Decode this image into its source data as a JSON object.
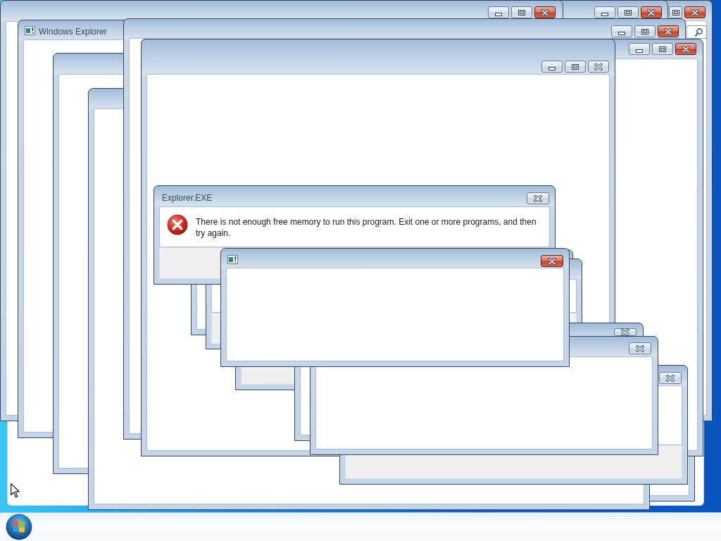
{
  "windows": [
    {
      "kind": "backdrop"
    },
    {
      "kind": "window",
      "active": true,
      "buttons": [
        {
          "kind": "maximize"
        },
        {
          "kind": "close"
        }
      ],
      "search_field": true
    },
    {
      "kind": "window",
      "active": true,
      "buttons": [
        {
          "kind": "minimize"
        },
        {
          "kind": "maximize"
        },
        {
          "kind": "close"
        }
      ]
    },
    {
      "kind": "window",
      "active": true,
      "buttons": [
        {
          "kind": "minimize"
        },
        {
          "kind": "maximize"
        },
        {
          "kind": "close"
        }
      ]
    },
    {
      "kind": "window",
      "app_icon": true,
      "title": "Windows Explorer"
    },
    {
      "kind": "window"
    },
    {
      "kind": "window"
    },
    {
      "kind": "window"
    },
    {
      "kind": "window",
      "active": true,
      "buttons": [
        {
          "kind": "minimize"
        },
        {
          "kind": "maximize"
        },
        {
          "kind": "close"
        }
      ]
    },
    {
      "kind": "window",
      "active": true,
      "buttons": [
        {
          "kind": "minimize"
        },
        {
          "kind": "maximize"
        },
        {
          "kind": "close"
        }
      ]
    },
    {
      "kind": "window",
      "active": false,
      "buttons": [
        {
          "kind": "minimize"
        },
        {
          "kind": "maximize"
        },
        {
          "kind": "close"
        }
      ]
    },
    {
      "kind": "window"
    },
    {
      "kind": "dialog"
    },
    {
      "kind": "dialog"
    },
    {
      "kind": "window",
      "active": false,
      "buttons": [
        {
          "kind": "close"
        }
      ]
    },
    {
      "kind": "dialog",
      "active": false,
      "buttons": [
        {
          "kind": "close"
        }
      ]
    },
    {
      "kind": "window",
      "active": false,
      "buttons": [
        {
          "kind": "close"
        }
      ]
    },
    {
      "kind": "dialog",
      "title": "Explorer.EXE",
      "active": false,
      "buttons": [
        {
          "kind": "close"
        }
      ],
      "message": "There is not enough free memory to run this program. Exit one or more programs, and then try again."
    },
    {
      "kind": "window",
      "app_icon": true,
      "active": true,
      "buttons": [
        {
          "kind": "close"
        }
      ]
    }
  ]
}
